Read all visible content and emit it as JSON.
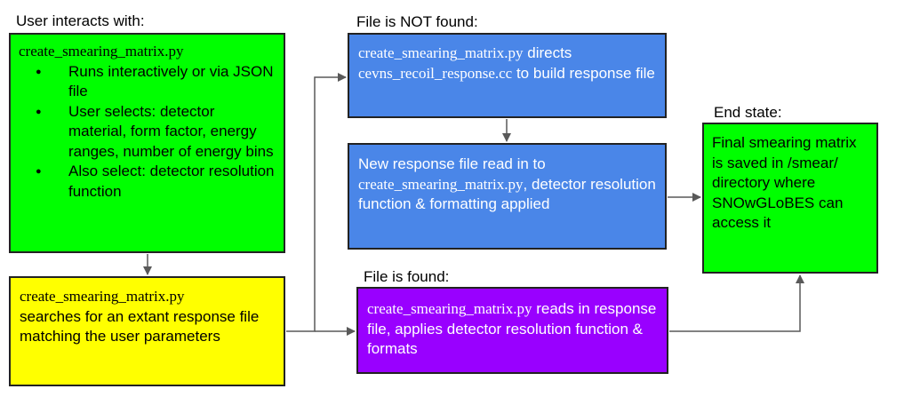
{
  "colors": {
    "green": "#00ff00",
    "yellow": "#ffff00",
    "blue": "#4a86e8",
    "purple": "#9900ff",
    "arrow": "#595959",
    "border": "#222222"
  },
  "captions": {
    "user": "User interacts with:",
    "not_found": "File is NOT found:",
    "found": "File is found:",
    "end": "End state:"
  },
  "user_box": {
    "script": "create_smearing_matrix.py",
    "bullets": [
      "Runs interactively or via JSON file",
      "User selects: detector material, form factor, energy ranges, number of energy bins",
      "Also select: detector resolution function"
    ]
  },
  "search_box": {
    "script": "create_smearing_matrix.py",
    "text": "searches for an extant response file matching the user parameters"
  },
  "notfound_box": {
    "script": "create_smearing_matrix.py",
    "text_a": " directs ",
    "script2": "cevns_recoil_response.cc",
    "text_b": " to build response file"
  },
  "newresp_box": {
    "text_a": "New response file read in to ",
    "script": "create_smearing_matrix.py",
    "text_b": ", detector resolution function & formatting applied"
  },
  "found_box": {
    "script": "create_smearing_matrix.py",
    "text": " reads in response file, applies detector resolution function & formats"
  },
  "end_box": {
    "text": "Final smearing matrix is saved in /smear/ directory where SNOwGLoBES can access it"
  }
}
